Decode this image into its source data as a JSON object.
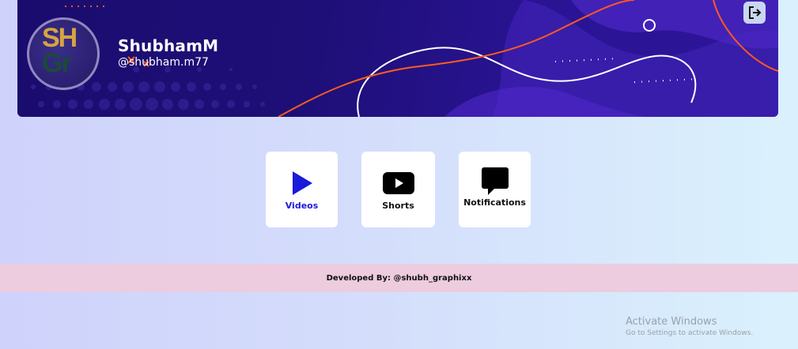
{
  "profile": {
    "avatar_monogram_top": "SH",
    "avatar_monogram_bottom": "Gr",
    "display_name": "ShubhamM",
    "handle": "@shubham.m77"
  },
  "header": {
    "logout_icon": "logout-icon"
  },
  "nav": {
    "cards": [
      {
        "label": "Videos",
        "icon": "play-icon",
        "color": "#1a1ad9"
      },
      {
        "label": "Shorts",
        "icon": "youtube-icon",
        "color": "#111111"
      },
      {
        "label": "Notifications",
        "icon": "message-icon",
        "color": "#111111"
      }
    ]
  },
  "footer": {
    "text": "Developed By: @shubh_graphixx"
  },
  "watermark": {
    "title": "Activate Windows",
    "subtitle": "Go to Settings to activate Windows."
  },
  "colors": {
    "banner": "#1e0f78",
    "accent_orange": "#ff5a1f",
    "footer_bg": "#ecccde",
    "card_bg": "#ffffff"
  }
}
